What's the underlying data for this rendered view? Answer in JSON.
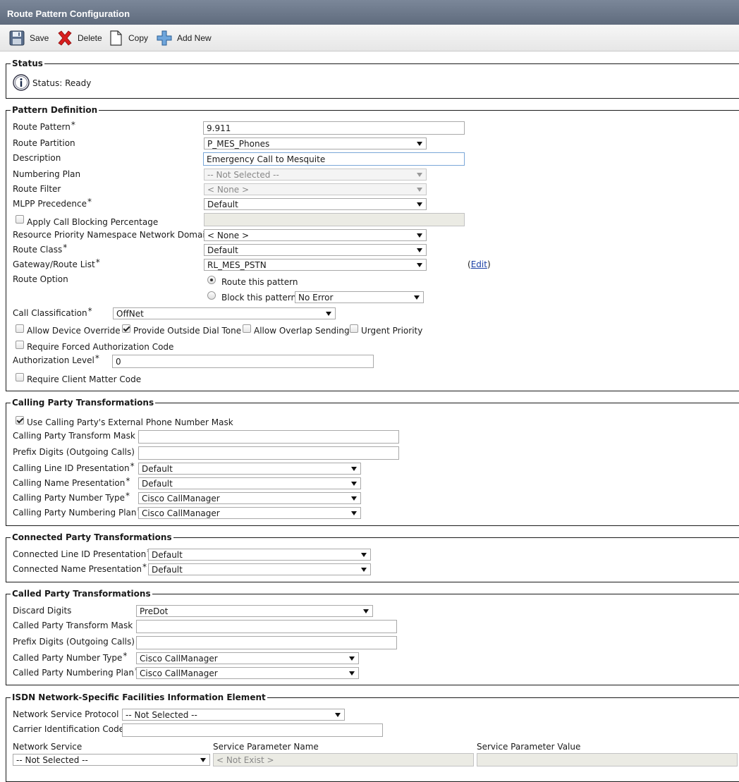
{
  "title": "Route Pattern Configuration",
  "toolbar": {
    "save": "Save",
    "delete": "Delete",
    "copy": "Copy",
    "add_new": "Add New"
  },
  "status": {
    "legend": "Status",
    "text": "Status: Ready"
  },
  "pattern": {
    "legend": "Pattern Definition",
    "route_pattern_label": "Route Pattern",
    "route_pattern_value": "9.911",
    "route_partition_label": "Route Partition",
    "route_partition_value": "P_MES_Phones",
    "description_label": "Description",
    "description_value": "Emergency Call to Mesquite",
    "numbering_plan_label": "Numbering Plan",
    "numbering_plan_value": "-- Not Selected --",
    "route_filter_label": "Route Filter",
    "route_filter_value": "< None >",
    "mlpp_label": "MLPP Precedence",
    "mlpp_value": "Default",
    "call_blocking_label": "Apply Call Blocking Percentage",
    "resource_priority_label": "Resource Priority Namespace Network Domain",
    "resource_priority_value": "< None >",
    "route_class_label": "Route Class",
    "route_class_value": "Default",
    "gateway_label": "Gateway/Route List",
    "gateway_value": "RL_MES_PSTN",
    "edit_link": "Edit",
    "route_option_label": "Route Option",
    "route_this_label": "Route this pattern",
    "block_this_label": "Block this pattern",
    "block_reason_value": "No Error",
    "call_classification_label": "Call Classification",
    "call_classification_value": "OffNet",
    "allow_device_override_label": "Allow Device Override",
    "provide_dial_tone_label": "Provide Outside Dial Tone",
    "allow_overlap_label": "Allow Overlap Sending",
    "urgent_priority_label": "Urgent Priority",
    "require_fac_label": "Require Forced Authorization Code",
    "auth_level_label": "Authorization Level",
    "auth_level_value": "0",
    "require_cmc_label": "Require Client Matter Code"
  },
  "calling": {
    "legend": "Calling Party Transformations",
    "use_mask_label": "Use Calling Party's External Phone Number Mask",
    "transform_mask_label": "Calling Party Transform Mask",
    "prefix_label": "Prefix Digits (Outgoing Calls)",
    "line_id_label": "Calling Line ID Presentation",
    "line_id_value": "Default",
    "name_pres_label": "Calling Name Presentation",
    "name_pres_value": "Default",
    "number_type_label": "Calling Party Number Type",
    "number_type_value": "Cisco CallManager",
    "numbering_plan_label": "Calling Party Numbering Plan",
    "numbering_plan_value": "Cisco CallManager"
  },
  "connected": {
    "legend": "Connected Party Transformations",
    "line_id_label": "Connected Line ID Presentation",
    "line_id_value": "Default",
    "name_label": "Connected Name Presentation",
    "name_value": "Default"
  },
  "called": {
    "legend": "Called Party Transformations",
    "discard_label": "Discard Digits",
    "discard_value": "PreDot",
    "transform_mask_label": "Called Party Transform Mask",
    "prefix_label": "Prefix Digits (Outgoing Calls)",
    "number_type_label": "Called Party Number Type",
    "number_type_value": "Cisco CallManager",
    "numbering_plan_label": "Called Party Numbering Plan",
    "numbering_plan_value": "Cisco CallManager"
  },
  "isdn": {
    "legend": "ISDN Network-Specific Facilities Information Element",
    "nsp_label": "Network Service Protocol",
    "nsp_value": "-- Not Selected --",
    "carrier_label": "Carrier Identification Code",
    "network_service_label": "Network Service",
    "network_service_value": "-- Not Selected --",
    "param_name_label": "Service Parameter Name",
    "param_name_value": "< Not Exist >",
    "param_value_label": "Service Parameter Value"
  },
  "required_marker": "*"
}
